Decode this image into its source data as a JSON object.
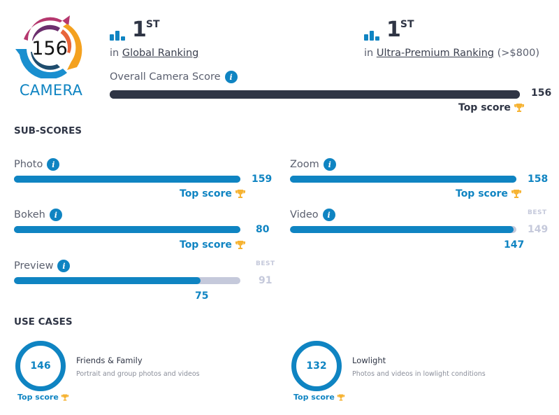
{
  "logo": {
    "score": "156",
    "label": "CAMERA",
    "colors": [
      "#b5376e",
      "#e8643a",
      "#f4a11f",
      "#1f4d6e",
      "#1a8fcf",
      "#6c2f6e"
    ]
  },
  "rankings": [
    {
      "icon": "bar-chart-icon",
      "rank": "1",
      "suffix": "ST",
      "prefix": "in",
      "link": "Global Ranking",
      "extra": ""
    },
    {
      "icon": "bar-chart-icon",
      "rank": "1",
      "suffix": "ST",
      "prefix": "in",
      "link": "Ultra-Premium Ranking",
      "extra": "(>$800)"
    }
  ],
  "overall": {
    "label": "Overall Camera Score",
    "value": "156",
    "fraction": 1.0,
    "badge": "Top score"
  },
  "sub_scores": {
    "title": "SUB-SCORES",
    "best_label": "BEST",
    "items": [
      {
        "name": "Photo",
        "value": "159",
        "best": "159",
        "fraction": 1.0,
        "top": true,
        "badge": "Top score"
      },
      {
        "name": "Zoom",
        "value": "158",
        "best": "158",
        "fraction": 1.0,
        "top": true,
        "badge": "Top score"
      },
      {
        "name": "Bokeh",
        "value": "80",
        "best": "80",
        "fraction": 1.0,
        "top": true,
        "badge": "Top score"
      },
      {
        "name": "Video",
        "value": "147",
        "best": "149",
        "fraction": 0.987,
        "top": false,
        "badge": ""
      },
      {
        "name": "Preview",
        "value": "75",
        "best": "91",
        "fraction": 0.824,
        "top": false,
        "badge": ""
      }
    ]
  },
  "use_cases": {
    "title": "USE CASES",
    "items": [
      {
        "score": "146",
        "title": "Friends & Family",
        "desc": "Portrait and group photos and videos",
        "badge": "Top score"
      },
      {
        "score": "132",
        "title": "Lowlight",
        "desc": "Photos and videos in lowlight conditions",
        "badge": "Top score"
      }
    ]
  },
  "colors": {
    "accent": "#0f84c2",
    "dark": "#2f3545",
    "best_gray": "#c5c9db",
    "trophy": "#f6b333"
  }
}
